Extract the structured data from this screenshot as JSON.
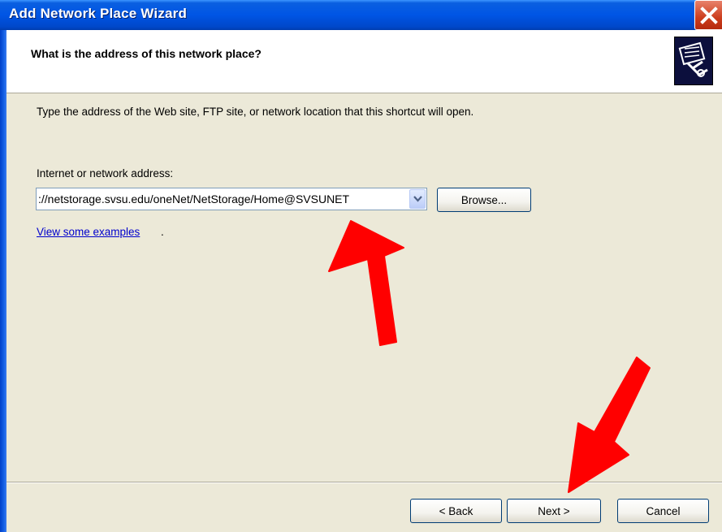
{
  "window": {
    "title": "Add Network Place Wizard"
  },
  "header": {
    "title": "What is the address of this network place?",
    "icon": "network-place-icon"
  },
  "content": {
    "instruction": "Type the address of the Web site, FTP site, or network location that this shortcut will open.",
    "address_label": "Internet or network address:",
    "address_value": "://netstorage.svsu.edu/oneNet/NetStorage/Home@SVSUNET",
    "browse_label": "Browse...",
    "examples_link": "View some examples",
    "examples_suffix": "."
  },
  "footer": {
    "back_label": "< Back",
    "next_label": "Next >",
    "cancel_label": "Cancel"
  },
  "annotations": {
    "arrow_color": "#ff0000",
    "arrows": [
      "arrow-to-address-field",
      "arrow-to-next-button"
    ]
  },
  "colors": {
    "titlebar": "#0055e5",
    "dialog_bg": "#ece9d8",
    "link": "#0000cc"
  }
}
